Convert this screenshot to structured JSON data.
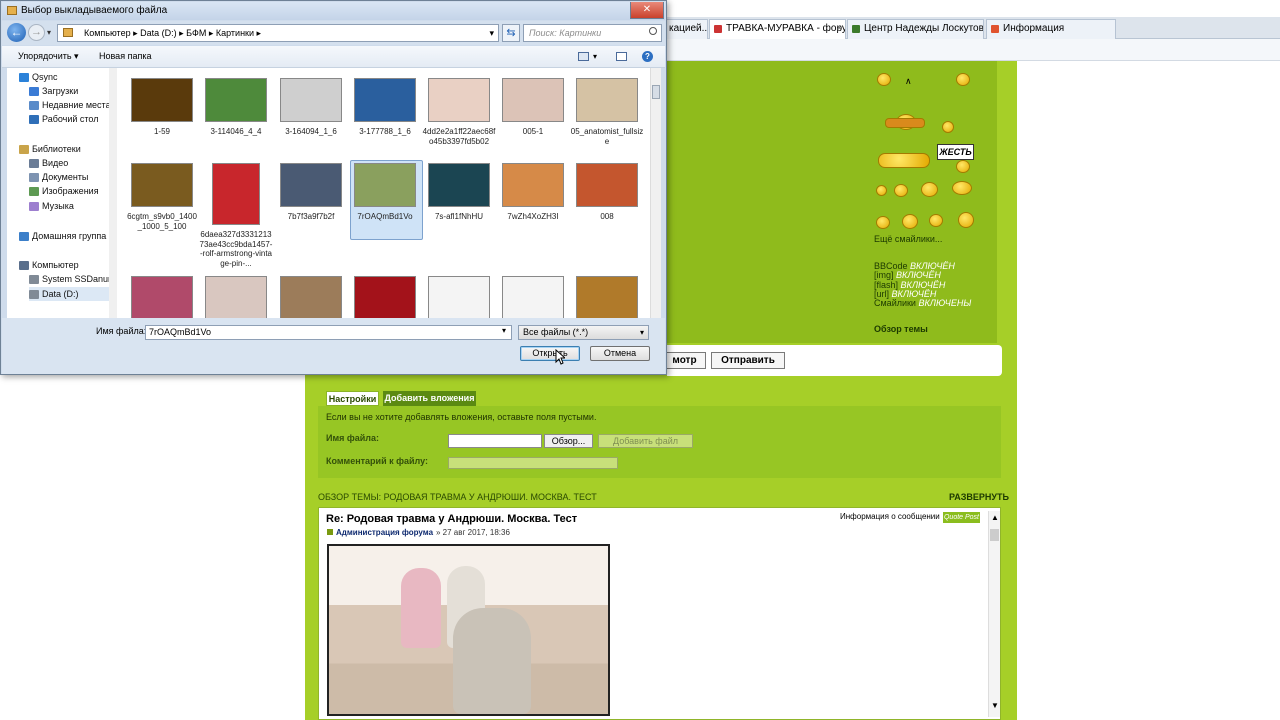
{
  "browser": {
    "tabs": [
      {
        "label": "кацией..."
      },
      {
        "label": "ТРАВКА-МУРАВКА - фору..."
      },
      {
        "label": "Центр Надежды Лоскутовой..."
      },
      {
        "label": "Информация"
      }
    ]
  },
  "forum": {
    "more_smilies": "Ещё смайлики...",
    "bbcode": [
      {
        "name": "BBCode",
        "state": "ВКЛЮЧЁН"
      },
      {
        "name": "[img]",
        "state": "ВКЛЮЧЁН"
      },
      {
        "name": "[flash]",
        "state": "ВКЛЮЧЁН"
      },
      {
        "name": "[url]",
        "state": "ВКЛЮЧЁН"
      },
      {
        "name": "Смайлики",
        "state": "ВКЛЮЧЕНЫ"
      }
    ],
    "topic_review": "Обзор темы",
    "smiley_bubble": "ЖЕСТЬ",
    "preview_btn": "мотр",
    "submit_btn": "Отправить",
    "tab_settings": "Настройки",
    "tab_attach": "Добавить вложения",
    "attach_hint": "Если вы не хотите добавлять вложения, оставьте поля пустыми.",
    "file_label": "Имя файла:",
    "browse_btn": "Обзор...",
    "add_file_btn": "Добавить файл",
    "comment_label": "Комментарий к файлу:",
    "review_header": "ОБЗОР ТЕМЫ: РОДОВАЯ ТРАВМА У АНДРЮШИ. МОСКВА. ТЕСТ",
    "expand": "РАЗВЕРНУТЬ",
    "post_title": "Re: Родовая травма у Андрюши. Москва. Тест",
    "post_info": "Информация о сообщении",
    "quote_btn": "Quote Post",
    "post_author": "Администрация форума",
    "post_date": "» 27 авг 2017, 18:36"
  },
  "dialog": {
    "title": "Выбор выкладываемого файла",
    "breadcrumb": [
      "Компьютер",
      "Data (D:)",
      "БФМ",
      "Картинки"
    ],
    "search_placeholder": "Поиск: Картинки",
    "organize": "Упорядочить ▾",
    "new_folder": "Новая папка",
    "nav": [
      {
        "label": "Qsync",
        "color": "#2b82d9"
      },
      {
        "label": "Загрузки",
        "color": "#3a7bd5"
      },
      {
        "label": "Недавние места",
        "color": "#5a8bc9"
      },
      {
        "label": "Рабочий стол",
        "color": "#2f6fb8"
      },
      {
        "label": "Библиотеки",
        "color": "#c9a44a"
      },
      {
        "label": "Видео",
        "color": "#6a7c96"
      },
      {
        "label": "Документы",
        "color": "#7d93b1"
      },
      {
        "label": "Изображения",
        "color": "#5e9a53"
      },
      {
        "label": "Музыка",
        "color": "#9d7fcf"
      },
      {
        "label": "Домашняя группа",
        "color": "#3c7fc9"
      },
      {
        "label": "Компьютер",
        "color": "#5a6f8c"
      },
      {
        "label": "System SSDanuм",
        "color": "#808a96"
      },
      {
        "label": "Data (D:)",
        "color": "#808a96"
      }
    ],
    "files": [
      {
        "name": "1-59",
        "color": "#5a3a0c"
      },
      {
        "name": "3-114046_4_4",
        "color": "#4e8a3b"
      },
      {
        "name": "3-164094_1_6",
        "color": "#cfcfcf"
      },
      {
        "name": "3-177788_1_6",
        "color": "#2a5f9e"
      },
      {
        "name": "4dd2e2a1ff22aec68fo45b3397fd5b02",
        "color": "#e9d0c4"
      },
      {
        "name": "005-1",
        "color": "#dcc3b7"
      },
      {
        "name": "05_anatomist_fullsize",
        "color": "#d5c2a4"
      },
      {
        "name": "6cgtm_s9vb0_1400_1000_5_100",
        "color": "#7a5b1f"
      },
      {
        "name": "6daea327d333121373ae43cc9bda1457--rolf-armstrong-vintage-pin-...",
        "color": "#c8262c"
      },
      {
        "name": "7b7f3a9f7b2f",
        "color": "#4a5a73"
      },
      {
        "name": "7rOAQmBd1Vo",
        "color": "#8aa05e"
      },
      {
        "name": "7s-afl1fNhHU",
        "color": "#1b4552"
      },
      {
        "name": "7wZh4XoZH3I",
        "color": "#d68a48"
      },
      {
        "name": "008",
        "color": "#c4562e"
      },
      {
        "name": "",
        "color": "#b04a6a"
      },
      {
        "name": "",
        "color": "#d9c7c0"
      },
      {
        "name": "",
        "color": "#9c7c5a"
      },
      {
        "name": "",
        "color": "#a3121a"
      },
      {
        "name": "",
        "color": "#f4f4f4"
      },
      {
        "name": "",
        "color": "#f4f4f4"
      },
      {
        "name": "",
        "color": "#b07a2a"
      }
    ],
    "filename_label": "Имя файла:",
    "filename_value": "7rOAQmBd1Vo",
    "filetype": "Все файлы (*.*)",
    "open_btn": "Открыть",
    "cancel_btn": "Отмена"
  }
}
